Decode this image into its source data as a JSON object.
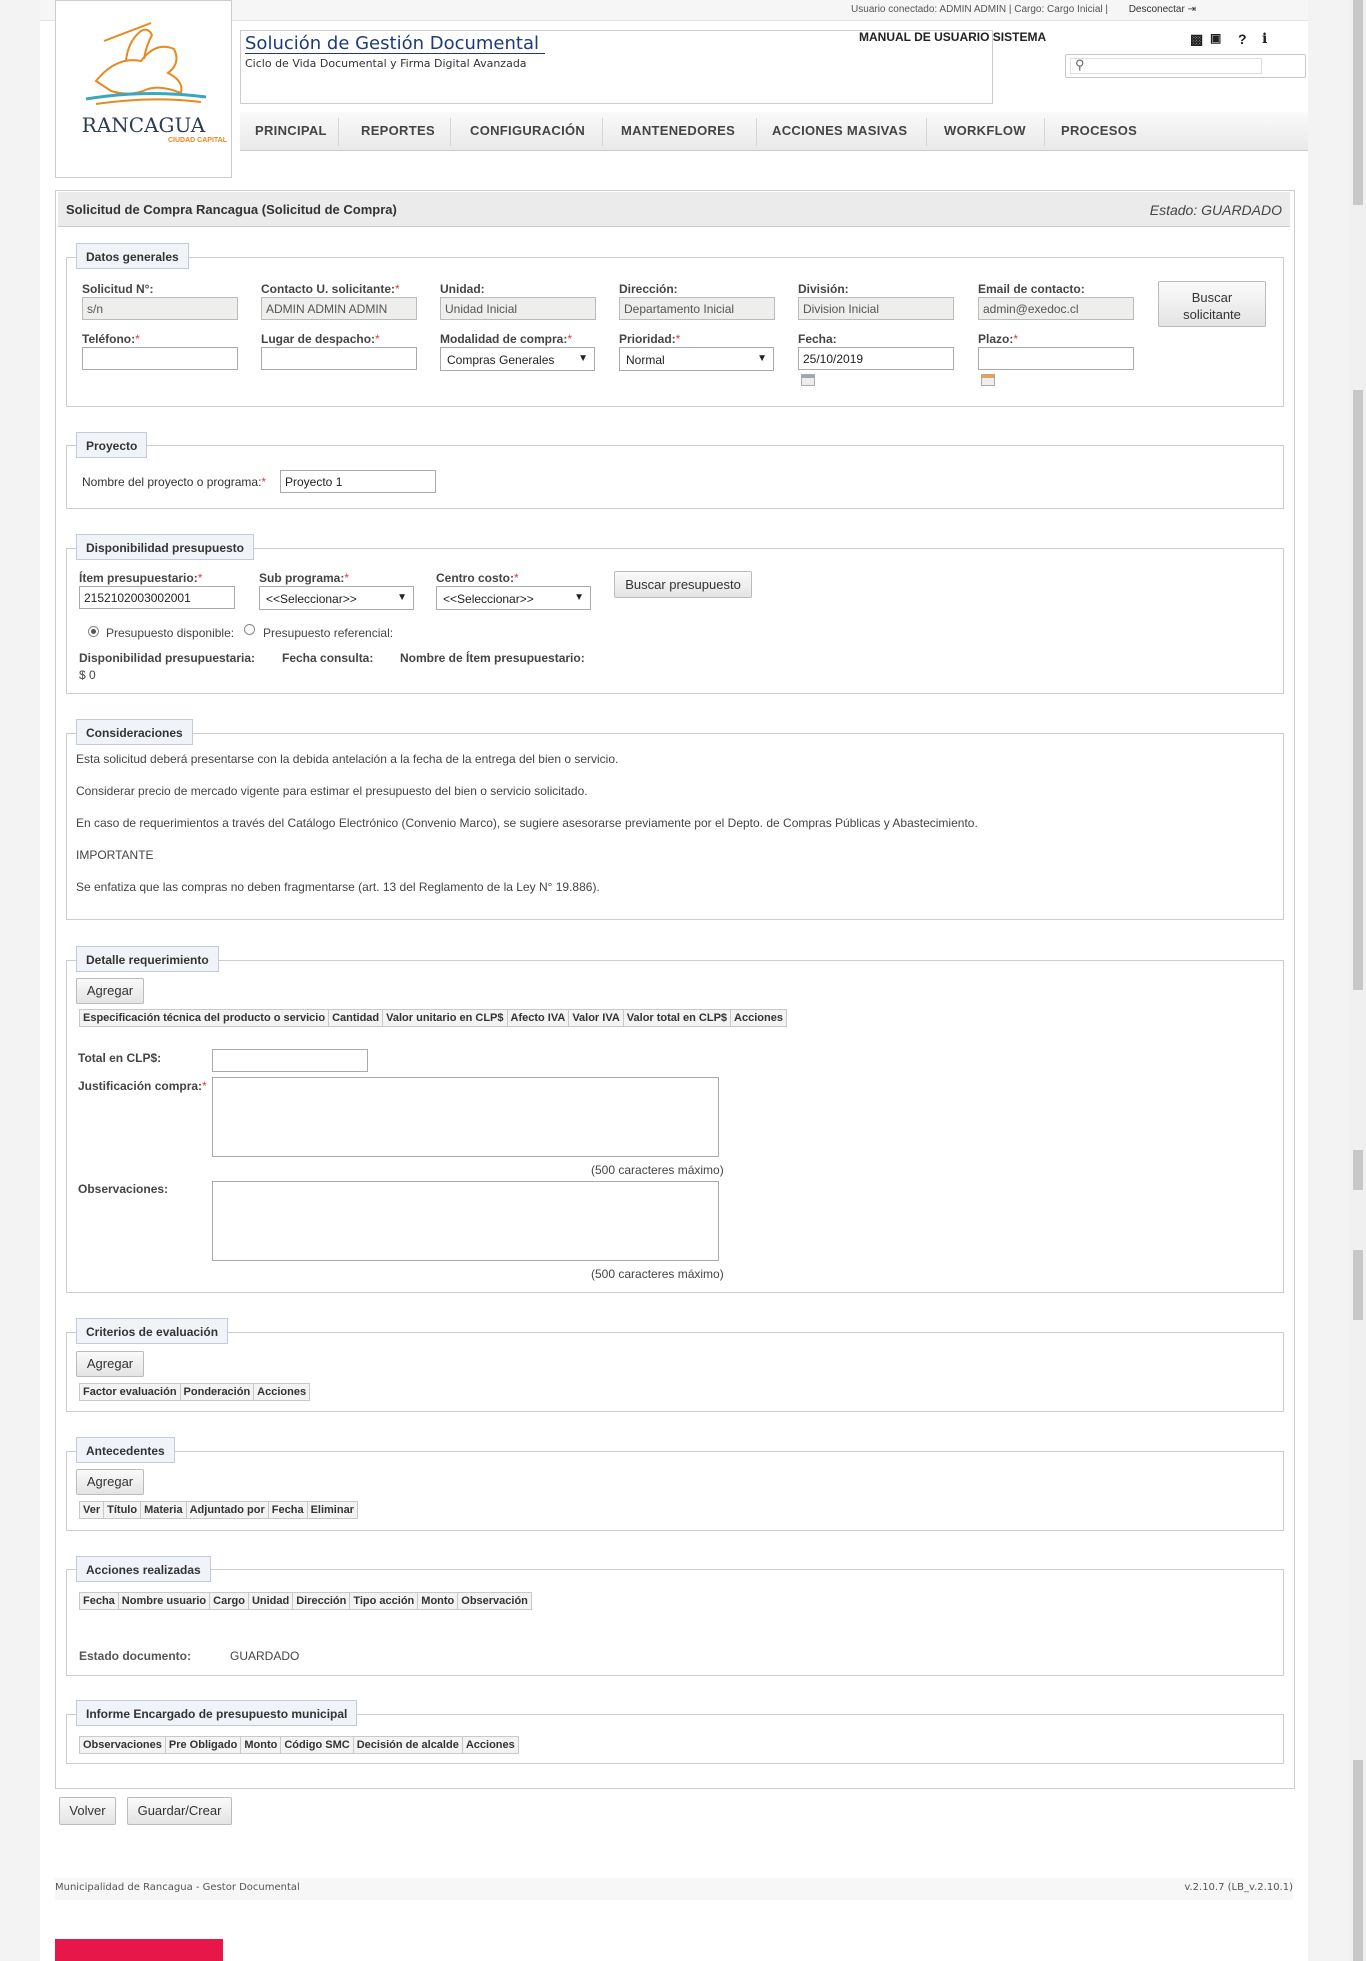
{
  "header": {
    "user_info": "Usuario conectado: ADMIN ADMIN | Cargo: Cargo Inicial |",
    "logout": "Desconectar",
    "logo_city": "RANCAGUA",
    "logo_sub": "CIUDAD CAPITAL",
    "app_title": "Solución de Gestión Documental",
    "app_subtitle": "Ciclo de Vida Documental y Firma Digital Avanzada",
    "manual": "MANUAL DE USUARIO SISTEMA",
    "search_placeholder": ""
  },
  "nav": [
    "PRINCIPAL",
    "REPORTES",
    "CONFIGURACIÓN",
    "MANTENEDORES",
    "ACCIONES MASIVAS",
    "WORKFLOW",
    "PROCESOS"
  ],
  "doc": {
    "title": "Solicitud de Compra Rancagua (Solicitud de Compra)",
    "state": "Estado: GUARDADO"
  },
  "general": {
    "legend": "Datos generales",
    "solicitud_label": "Solicitud N°:",
    "solicitud_value": "s/n",
    "contacto_label": "Contacto U. solicitante:",
    "contacto_value": "ADMIN ADMIN ADMIN",
    "unidad_label": "Unidad:",
    "unidad_value": "Unidad Inicial",
    "direccion_label": "Dirección:",
    "direccion_value": "Departamento Inicial",
    "division_label": "División:",
    "division_value": "Division Inicial",
    "email_label": "Email de contacto:",
    "email_value": "admin@exedoc.cl",
    "buscar_line1": "Buscar",
    "buscar_line2": "solicitante",
    "telefono_label": "Teléfono:",
    "telefono_value": "",
    "lugar_label": "Lugar de despacho:",
    "lugar_value": "",
    "modalidad_label": "Modalidad de compra:",
    "modalidad_value": "Compras Generales",
    "prioridad_label": "Prioridad:",
    "prioridad_value": "Normal",
    "fecha_label": "Fecha:",
    "fecha_value": "25/10/2019",
    "plazo_label": "Plazo:",
    "plazo_value": ""
  },
  "proyecto": {
    "legend": "Proyecto",
    "label": "Nombre del proyecto o programa:",
    "value": "Proyecto 1"
  },
  "presupuesto": {
    "legend": "Disponibilidad presupuesto",
    "item_label": "Ítem presupuestario:",
    "item_value": "2152102003002001",
    "subprograma_label": "Sub programa:",
    "subprograma_value": "<<Seleccionar>>",
    "centro_label": "Centro costo:",
    "centro_value": "<<Seleccionar>>",
    "buscar": "Buscar presupuesto",
    "radio_disponible": "Presupuesto disponible:",
    "radio_referencial": "Presupuesto referencial:",
    "disp_label": "Disponibilidad presupuestaria:",
    "disp_value": "$ 0",
    "fecha_consulta_label": "Fecha consulta:",
    "nombre_item_label": "Nombre de Ítem presupuestario:"
  },
  "consideraciones": {
    "legend": "Consideraciones",
    "lines": [
      "Esta solicitud deberá presentarse con la debida antelación a la fecha de la entrega del bien o servicio.",
      "Considerar precio de mercado vigente para estimar el presupuesto del bien o servicio solicitado.",
      "En caso de requerimientos a través del Catálogo Electrónico (Convenio Marco), se sugiere asesorarse previamente por el Depto. de Compras Públicas y Abastecimiento.",
      "IMPORTANTE",
      "Se enfatiza que las compras no deben fragmentarse (art. 13 del Reglamento de la Ley N° 19.886)."
    ]
  },
  "detalle": {
    "legend": "Detalle requerimiento",
    "agregar": "Agregar",
    "columns": [
      "Especificación técnica del producto o servicio",
      "Cantidad",
      "Valor unitario en CLP$",
      "Afecto IVA",
      "Valor IVA",
      "Valor total en CLP$",
      "Acciones"
    ],
    "total_label": "Total en CLP$:",
    "justificacion_label": "Justificación compra:",
    "observaciones_label": "Observaciones:",
    "max_chars": "(500 caracteres máximo)"
  },
  "criterios": {
    "legend": "Criterios de evaluación",
    "agregar": "Agregar",
    "columns": [
      "Factor evaluación",
      "Ponderación",
      "Acciones"
    ]
  },
  "antecedentes": {
    "legend": "Antecedentes",
    "agregar": "Agregar",
    "columns": [
      "Ver",
      "Título",
      "Materia",
      "Adjuntado por",
      "Fecha",
      "Eliminar"
    ]
  },
  "acciones": {
    "legend": "Acciones realizadas",
    "columns": [
      "Fecha",
      "Nombre usuario",
      "Cargo",
      "Unidad",
      "Dirección",
      "Tipo acción",
      "Monto",
      "Observación"
    ],
    "estado_label": "Estado documento:",
    "estado_value": "GUARDADO"
  },
  "informe": {
    "legend": "Informe Encargado de presupuesto municipal",
    "columns": [
      "Observaciones",
      "Pre Obligado",
      "Monto",
      "Código SMC",
      "Decisión de alcalde",
      "Acciones"
    ]
  },
  "actions": {
    "volver": "Volver",
    "guardar": "Guardar/Crear"
  },
  "footer": {
    "left": "Municipalidad de Rancagua - Gestor Documental",
    "right": "v.2.10.7 (LB_v.2.10.1)"
  },
  "colors": {
    "accent_blue": "#1f3a7a",
    "logo_orange": "#e8891e",
    "required_red": "#d43f3a",
    "footer_red": "#e8174a"
  },
  "icons": [
    "book-icon",
    "id-card-icon",
    "help-icon",
    "info-icon",
    "search-icon",
    "calendar-icon",
    "logout-icon"
  ]
}
